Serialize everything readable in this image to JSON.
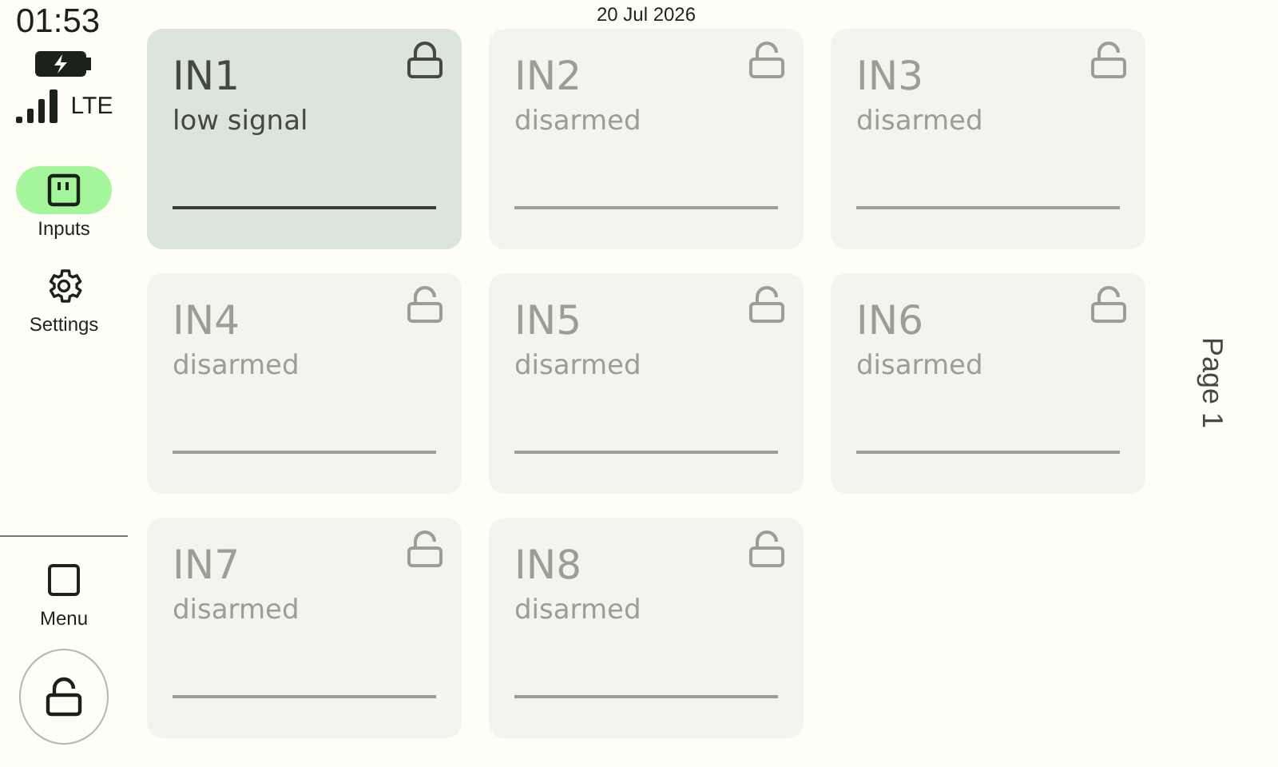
{
  "status": {
    "time": "01:53",
    "network": "LTE"
  },
  "date": "20 Jul 2026",
  "nav": [
    {
      "label": "Inputs",
      "kind": "inputs",
      "selected": true
    },
    {
      "label": "Settings",
      "kind": "settings",
      "selected": false
    }
  ],
  "menu": {
    "label": "Menu"
  },
  "lock_button": {
    "locked": false
  },
  "inputs": [
    {
      "name": "IN1",
      "status": "low signal",
      "armed": true
    },
    {
      "name": "IN2",
      "status": "disarmed",
      "armed": false
    },
    {
      "name": "IN3",
      "status": "disarmed",
      "armed": false
    },
    {
      "name": "IN4",
      "status": "disarmed",
      "armed": false
    },
    {
      "name": "IN5",
      "status": "disarmed",
      "armed": false
    },
    {
      "name": "IN6",
      "status": "disarmed",
      "armed": false
    },
    {
      "name": "IN7",
      "status": "disarmed",
      "armed": false
    },
    {
      "name": "IN8",
      "status": "disarmed",
      "armed": false
    }
  ],
  "page_label": "Page 1"
}
